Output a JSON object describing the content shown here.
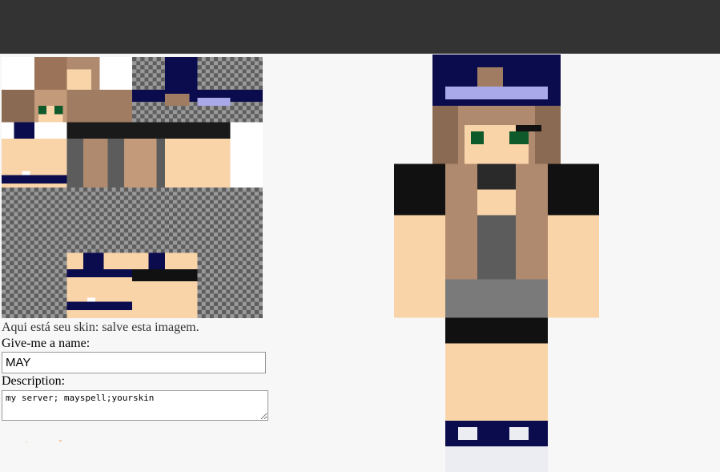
{
  "header": {
    "background": "#333333"
  },
  "skin_texture": {
    "description_icon": "skin-texture-map"
  },
  "save_caption": "Aqui está seu skin: salve esta imagem.",
  "name_field": {
    "label": "Give-me a name:",
    "value": "MAY"
  },
  "description_field": {
    "label": "Description:",
    "value": "my server; mayspell;yourskin"
  },
  "colors": {
    "hat": "#0b0c4d",
    "hat_band": "#a9a9ea",
    "hair_light": "#b08a6e",
    "hair_dark": "#6e4a32",
    "skin": "#f9d4a9",
    "shirt": "#5c5c5c",
    "sleeve": "#111111",
    "eye": "#0f5a2a",
    "shoe_white": "#ececf3"
  }
}
